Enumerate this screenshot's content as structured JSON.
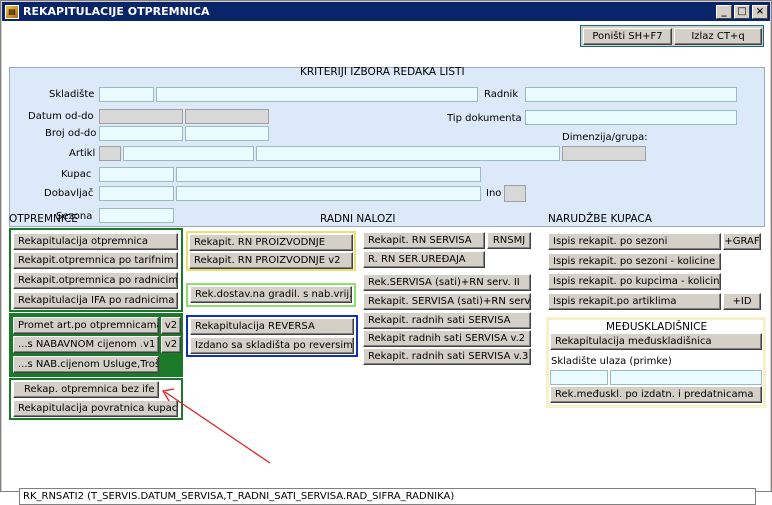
{
  "window": {
    "title": "REKAPITULACIJE OTPREMNICA",
    "controls": {
      "minimize": "_",
      "maximize": "□",
      "close": "×"
    }
  },
  "toolbar": {
    "ponisti_label": "Poništi SH+F7",
    "izlaz_label": "Izlaz CT+q"
  },
  "criteria": {
    "title": "KRITERIJI IZBORA REDAKA LISTI",
    "skladiste": "Skladište",
    "radnik": "Radnik",
    "datum": "Datum  od-do",
    "tip_dokumenta": "Tip dokumenta",
    "broj": "Broj od-do",
    "dimenzija": "Dimenzija/grupa:",
    "artikl": "Artikl",
    "kupac": "Kupac",
    "dobavljac": "Dobavljač",
    "ino": "Ino",
    "sezona": "Sezona"
  },
  "otpremnice": {
    "title": "OTPREMNICE",
    "items": [
      "Rekapitulacija otpremnica",
      "Rekapit.otpremnica po tarifnim br.",
      "Rekapit.otpremnica po radnicima",
      "Rekapitulacija IFA po radnicima"
    ],
    "promet": "Promet art.po otpremnicama",
    "nabavnom": "...s NABAVNOM cijenom .v1",
    "nab_usluge": "...s NAB.cijenom Usluge,Troš",
    "v2a": "v2",
    "v2b": "v2",
    "bez_ife": "Rekap. otpremnica bez ife",
    "povratnica": "Rekapitulacija povratnica kupaca"
  },
  "radni_nalozi": {
    "title": "RADNI NALOZI",
    "proizvodnje": "Rekapit. RN PROIZVODNJE",
    "proizvodnje_v2": "Rekapit. RN PROIZVODNJE v2",
    "dostav": "Rek.dostav.na gradil. s nab.vrij.",
    "reversa": "Rekapitulacija REVERSA",
    "izdano": "Izdano sa skladišta po reversima",
    "servisa": "Rekapit. RN SERVISA",
    "rnsmj": "RNSMJ",
    "ser_uredaja": "R. RN SER.UREĐAJA",
    "servisa_sati": "Rek.SERVISA (sati)+RN serv. II",
    "servisa_sati2": "Rekapit. SERVISA (sati)+RN serv",
    "radnih_sati": "Rekapit. radnih sati SERVISA",
    "radnih_sati_v2": "Rekapit radnih sati SERVISA v.2",
    "radnih_sati_v3": "Rekapit. radnih sati SERVISA v.3"
  },
  "narudzbe": {
    "title": "NARUDŽBE KUPACA",
    "sezoni": "Ispis rekapit. po sezoni",
    "graf": "+GRAF",
    "sezoni_kol": "Ispis rekapit. po sezoni - kolicine",
    "kupcima_kol": "Ispis rekapit. po kupcima - kolicine",
    "artiklima": "Ispis rekapit.po artiklima",
    "id": "+ID"
  },
  "meduskladisnice": {
    "title": "MEĐUSKLADIŠNICE",
    "rekap": "Rekapitulacija međuskladišnica",
    "skladiste_ulaza": "Skladište ulaza (primke)",
    "rek_izdatn": "Rek.međuskl. po izdatn. i predatnicama"
  },
  "status": {
    "text": "RK_RNSATI2 (T_SERVIS.DATUM_SERVISA,T_RADNI_SATI_SERVISA.RAD_SIFRA_RADNIKA)"
  },
  "colors": {
    "title_bg": "#0a246a",
    "green_border": "#1a7a2a",
    "yellow_border": "#e8e070",
    "blue_border": "#1030b0",
    "criteria_bg": "#dce9f8"
  }
}
